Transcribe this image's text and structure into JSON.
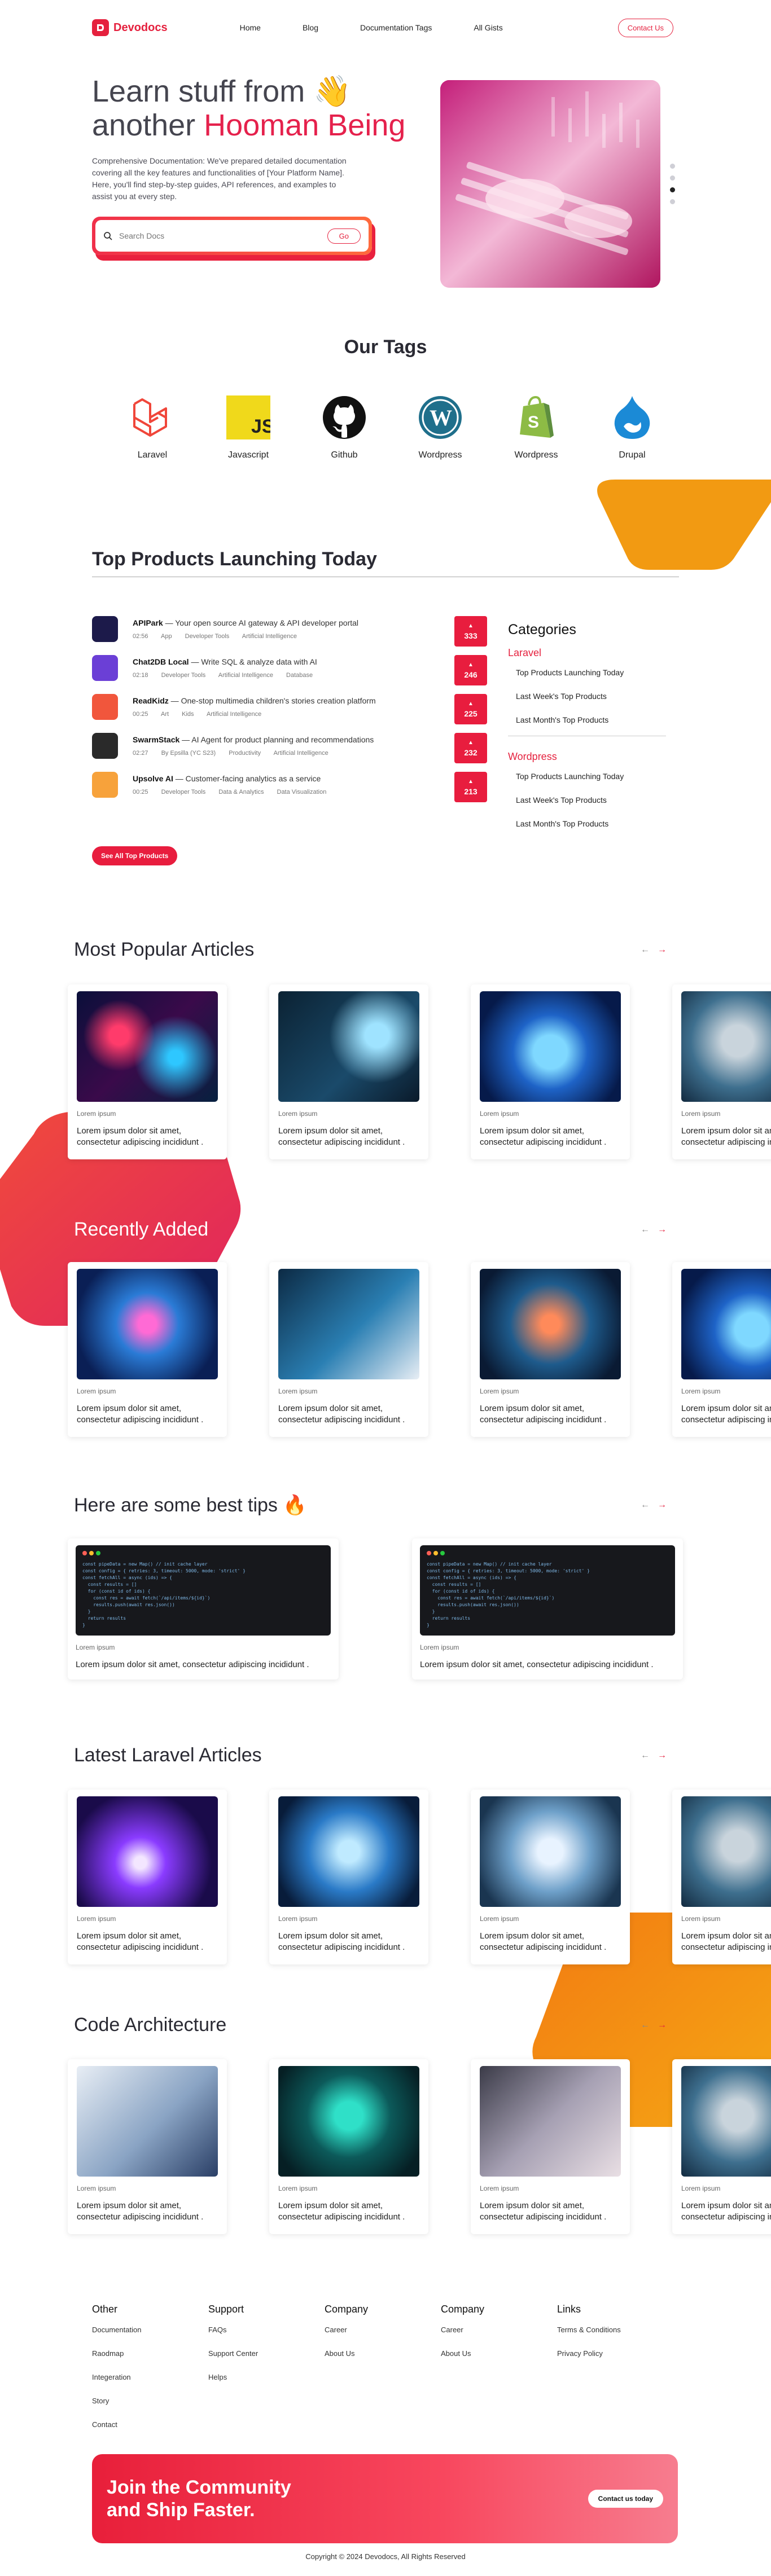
{
  "nav": {
    "logo": "Devodocs",
    "links": [
      "Home",
      "Blog",
      "Documentation Tags",
      "All Gists"
    ],
    "contact": "Contact Us"
  },
  "hero": {
    "title_line1": "Learn stuff from",
    "title_emoji": "👋",
    "title_line2_prefix": "another",
    "title_accent": "Hooman Being",
    "description": "Comprehensive Documentation: We've prepared detailed documentation covering all the key features and functionalities of [Your Platform Name]. Here, you'll find step-by-step guides, API references, and examples to assist you at every step.",
    "search_placeholder": "Search Docs",
    "go": "Go"
  },
  "tags": {
    "title": "Our Tags",
    "items": [
      {
        "label": "Laravel",
        "icon": "laravel-icon"
      },
      {
        "label": "Javascript",
        "icon": "javascript-icon"
      },
      {
        "label": "Github",
        "icon": "github-icon"
      },
      {
        "label": "Wordpress",
        "icon": "wordpress-icon"
      },
      {
        "label": "Wordpress",
        "icon": "shopify-icon"
      },
      {
        "label": "Drupal",
        "icon": "drupal-icon"
      }
    ]
  },
  "products": {
    "title": "Top Products Launching Today",
    "items": [
      {
        "name": "APIPark",
        "desc": " — Your open source AI gateway & API developer portal",
        "time": "02:56",
        "tags": [
          "App",
          "Developer Tools",
          "Artificial Intelligence"
        ],
        "votes": "333",
        "color": "#1c1a4a"
      },
      {
        "name": "Chat2DB Local",
        "desc": " — Write SQL & analyze data with AI",
        "time": "02:18",
        "tags": [
          "Developer Tools",
          "Artificial Intelligence",
          "Database"
        ],
        "votes": "246",
        "color": "#6b3fd6"
      },
      {
        "name": "ReadKidz",
        "desc": " — One-stop multimedia children's stories creation platform",
        "time": "00:25",
        "tags": [
          "Art",
          "Kids",
          "Artificial Intelligence"
        ],
        "votes": "225",
        "color": "#f1563c"
      },
      {
        "name": "SwarmStack",
        "desc": " — AI Agent for product planning and recommendations",
        "time": "02:27",
        "tags": [
          "By Epsilla (YC S23)",
          "Productivity",
          "Artificial Intelligence"
        ],
        "votes": "232",
        "color": "#2a2a2a"
      },
      {
        "name": "Upsolve AI",
        "desc": " — Customer-facing analytics as a service",
        "time": "00:25",
        "tags": [
          "Developer Tools",
          "Data & Analytics",
          "Data Visualization"
        ],
        "votes": "213",
        "color": "#f7a23b"
      }
    ],
    "see_all": "See All Top Products"
  },
  "categories": {
    "title": "Categories",
    "groups": [
      {
        "name": "Laravel",
        "links": [
          "Top Products Launching Today",
          "Last Week's Top Products",
          "Last Month's Top Products"
        ]
      },
      {
        "name": "Wordpress",
        "links": [
          "Top Products Launching Today",
          "Last Week's Top Products",
          "Last Month's Top Products"
        ]
      }
    ]
  },
  "sections": [
    {
      "title": "Most Popular Articles",
      "cards": [
        {
          "cat": "Lorem ipsum",
          "title": "Lorem ipsum dolor sit amet, consectetur adipiscing incididunt .",
          "img": "neon"
        },
        {
          "cat": "Lorem ipsum",
          "title": "Lorem ipsum dolor sit amet, consectetur adipiscing incididunt .",
          "img": "robot"
        },
        {
          "cat": "Lorem ipsum",
          "title": "Lorem ipsum dolor sit amet, consectetur adipiscing incididunt .",
          "img": "brain"
        },
        {
          "cat": "Lorem ipsum",
          "title": "Lorem ipsum dolor sit amet, consectetur adipiscing incididunt .",
          "img": "robot2"
        }
      ]
    },
    {
      "title": "Recently Added",
      "cards": [
        {
          "cat": "Lorem ipsum",
          "title": "Lorem ipsum dolor sit amet, consectetur adipiscing incididunt .",
          "img": "chip"
        },
        {
          "cat": "Lorem ipsum",
          "title": "Lorem ipsum dolor sit amet, consectetur adipiscing incididunt .",
          "img": "woman"
        },
        {
          "cat": "Lorem ipsum",
          "title": "Lorem ipsum dolor sit amet, consectetur adipiscing incididunt .",
          "img": "hands"
        },
        {
          "cat": "Lorem ipsum",
          "title": "Lorem ipsum dolor sit amet, consectetur adipiscing incididunt .",
          "img": "brain"
        }
      ]
    },
    {
      "title": "Latest Laravel Articles",
      "cards": [
        {
          "cat": "Lorem ipsum",
          "title": "Lorem ipsum dolor sit amet, consectetur adipiscing incididunt .",
          "img": "purple"
        },
        {
          "cat": "Lorem ipsum",
          "title": "Lorem ipsum dolor sit amet, consectetur adipiscing incididunt .",
          "img": "holo"
        },
        {
          "cat": "Lorem ipsum",
          "title": "Lorem ipsum dolor sit amet, consectetur adipiscing incididunt .",
          "img": "head"
        },
        {
          "cat": "Lorem ipsum",
          "title": "Lorem ipsum dolor sit amet, consectetur adipiscing incididunt .",
          "img": "robot2"
        }
      ]
    },
    {
      "title": "Code Architecture",
      "cards": [
        {
          "cat": "Lorem ipsum",
          "title": "Lorem ipsum dolor sit amet, consectetur adipiscing incididunt .",
          "img": "keyboard"
        },
        {
          "cat": "Lorem ipsum",
          "title": "Lorem ipsum dolor sit amet, consectetur adipiscing incididunt .",
          "img": "laptop"
        },
        {
          "cat": "Lorem ipsum",
          "title": "Lorem ipsum dolor sit amet, consectetur adipiscing incididunt .",
          "img": "desk"
        },
        {
          "cat": "Lorem ipsum",
          "title": "Lorem ipsum dolor sit amet, consectetur adipiscing incididunt .",
          "img": "robot2"
        }
      ]
    }
  ],
  "tips": {
    "title": "Here are some best tips",
    "emoji": "🔥",
    "cards": [
      {
        "cat": "Lorem ipsum",
        "title": "Lorem ipsum dolor sit amet, consectetur adipiscing incididunt ."
      },
      {
        "cat": "Lorem ipsum",
        "title": "Lorem ipsum dolor sit amet, consectetur adipiscing incididunt ."
      }
    ]
  },
  "arrows": {
    "prev": "←",
    "next": "→"
  },
  "footer": {
    "columns": [
      {
        "title": "Other",
        "links": [
          "Documentation",
          "Raodmap",
          "Integeration",
          "Story",
          "Contact"
        ]
      },
      {
        "title": "Support",
        "links": [
          "FAQs",
          "Support Center",
          "Helps"
        ]
      },
      {
        "title": "Company",
        "links": [
          "Career",
          "About Us"
        ]
      },
      {
        "title": "Company",
        "links": [
          "Career",
          "About Us"
        ]
      },
      {
        "title": "Links",
        "links": [
          "Terms & Conditions",
          "Privacy Policy"
        ]
      }
    ],
    "cta_line1": "Join the Community",
    "cta_line2": "and Ship Faster.",
    "cta_button": "Contact us today",
    "copyright": "Copyright © 2024 Devodocs, All Rights Reserved"
  },
  "colors": {
    "accent": "#e5213e",
    "orange": "#f29a12"
  }
}
